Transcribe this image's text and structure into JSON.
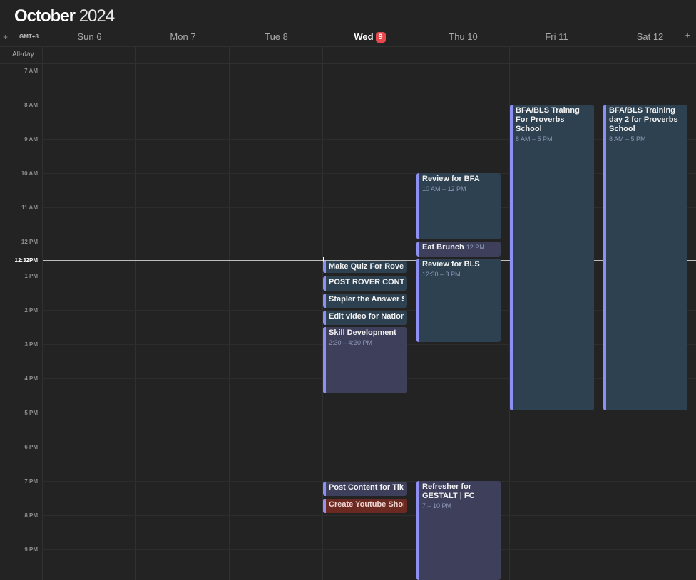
{
  "header": {
    "month": "October",
    "year": "2024",
    "add_label": "+",
    "timezone": "GMT+8",
    "right_control": "±",
    "allday_label": "All-day"
  },
  "days": [
    {
      "name": "Sun 6"
    },
    {
      "name": "Mon 7"
    },
    {
      "name": "Tue 8"
    },
    {
      "name": "Wed",
      "badge": "9",
      "today": true
    },
    {
      "name": "Thu 10"
    },
    {
      "name": "Fri 11"
    },
    {
      "name": "Sat 12"
    }
  ],
  "time_labels": [
    "7 AM",
    "8 AM",
    "9 AM",
    "10 AM",
    "11 AM",
    "12 PM",
    "1 PM",
    "2 PM",
    "3 PM",
    "4 PM",
    "5 PM",
    "6 PM",
    "7 PM",
    "8 PM",
    "9 PM"
  ],
  "now": {
    "label": "12:32PM"
  },
  "events": {
    "wed_quiz": {
      "title": "Make Quiz For Rover"
    },
    "wed_post_rover": {
      "title": "POST ROVER CONTENT"
    },
    "wed_stapler": {
      "title": "Stapler the Answer Sheets"
    },
    "wed_edit_video": {
      "title": "Edit video for National"
    },
    "wed_skill": {
      "title": "Skill Development",
      "time": "2:30 – 4:30 PM"
    },
    "wed_post_tiktok": {
      "title": "Post Content for Tiktok"
    },
    "wed_youtube": {
      "title": "Create Youtube Shorts"
    },
    "thu_review_bfa": {
      "title": "Review for BFA",
      "time": "10 AM – 12 PM"
    },
    "thu_brunch": {
      "title": "Eat Brunch",
      "time": "12 PM"
    },
    "thu_review_bls": {
      "title": "Review for BLS",
      "time": "12:30 – 3 PM"
    },
    "thu_refresher": {
      "title": "Refresher for GESTALT | FC",
      "time": "7 – 10 PM"
    },
    "fri_bfa": {
      "title": "BFA/BLS Trainng For Proverbs School",
      "time": "8 AM – 5 PM"
    },
    "sat_bfa": {
      "title": "BFA/BLS Training day 2 for Proverbs School",
      "time": "8 AM – 5 PM"
    }
  },
  "colors": {
    "event_blue": "#2d4150",
    "event_purple": "#3e3f5b",
    "event_red": "#6a2a22",
    "event_accent": "#8e8ff2",
    "today_badge": "#e5484d"
  }
}
